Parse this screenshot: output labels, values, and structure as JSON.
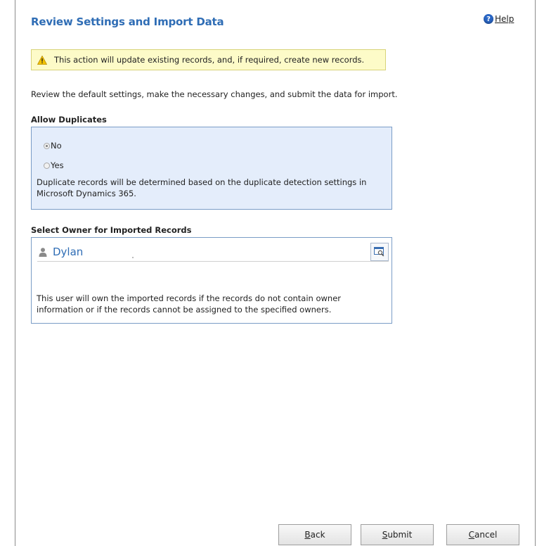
{
  "header": {
    "title": "Review Settings and Import Data",
    "help_label": "Help"
  },
  "warning": {
    "text": "This action will update existing records, and, if required, create new records."
  },
  "intro": "Review the default settings, make the necessary changes, and submit the data for import.",
  "allow_duplicates": {
    "label": "Allow Duplicates",
    "options": [
      {
        "label": "No",
        "selected": true
      },
      {
        "label": "Yes",
        "selected": false
      }
    ],
    "note": "Duplicate records will be determined based on the duplicate detection settings in Microsoft Dynamics 365."
  },
  "owner": {
    "label": "Select Owner for Imported Records",
    "value": "Dylan",
    "note": "This user will own the imported records if the records do not contain owner information or if the records cannot be assigned to the specified owners."
  },
  "buttons": {
    "back": {
      "first": "B",
      "rest": "ack"
    },
    "submit": {
      "first": "S",
      "rest": "ubmit"
    },
    "cancel": {
      "first": "C",
      "rest": "ancel"
    }
  },
  "colors": {
    "accent": "#2f6db5",
    "warning_bg": "#fdfbc8",
    "section_bg": "#e4edfb"
  }
}
